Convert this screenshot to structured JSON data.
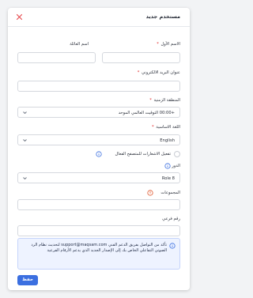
{
  "dialog": {
    "title": "مستخدم جديد"
  },
  "form": {
    "first_name_label": "الاسم الأول",
    "last_name_label": "اسم العائلة",
    "email_label": "عنوان البريد الالكتروني",
    "timezone_label": "المنطقة الزمنية",
    "timezone_value": "+00:00 التوقيت العالمي الموحد",
    "language_label": "اللغة الاساسية",
    "language_value": "English",
    "browser_notifications_label": "تفعيل الاشعارات للمتصفح الفعال",
    "role_label": "الدور",
    "role_value": "Role 8",
    "groups_label": "المجموعات",
    "extension_label": "رقم فرعي",
    "required_mark": "*"
  },
  "alert": {
    "message": "تأكد من التواصل بفريق الدعم الفني support@maqsam.com لتحديث نظام الرد الصوتي التفاعلي الخاص بك إلى الإصدار الجديد الذي يدعم الأرقام الفرعية"
  },
  "actions": {
    "save_label": "حفظ"
  },
  "colors": {
    "primary": "#3b6fe0",
    "required": "#e02424",
    "info": "#3b6fe0",
    "groups_warning": "#e0552b",
    "alert_bg": "#eef3ff"
  },
  "icons": {
    "close": "close-icon",
    "dropdown": "chevron-down-icon",
    "info": "info-icon"
  }
}
